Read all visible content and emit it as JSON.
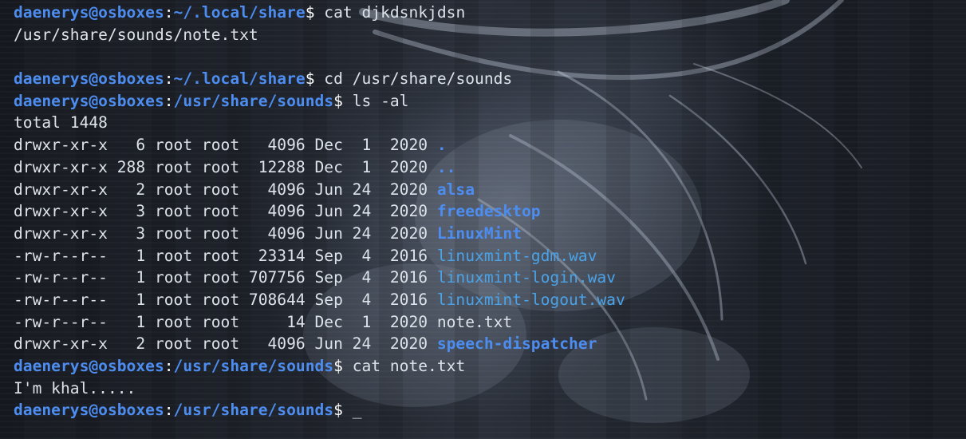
{
  "window": {
    "type": "terminal"
  },
  "colors": {
    "prompt": "#4d8df0",
    "text": "#dde3ea",
    "directory": "#4d8df0",
    "audio_file": "#4aa3e8"
  },
  "lines": [
    {
      "kind": "prompt",
      "user": "daenerys@osboxes",
      "path": "~/.local/share",
      "command": "cat djkdsnkjdsn"
    },
    {
      "kind": "text",
      "text": "/usr/share/sounds/note.txt"
    },
    {
      "kind": "blank",
      "text": ""
    },
    {
      "kind": "prompt",
      "user": "daenerys@osboxes",
      "path": "~/.local/share",
      "command": "cd /usr/share/sounds"
    },
    {
      "kind": "prompt",
      "user": "daenerys@osboxes",
      "path": "/usr/share/sounds",
      "command": "ls -al"
    },
    {
      "kind": "text",
      "text": "total 1448"
    },
    {
      "kind": "entry",
      "meta": "drwxr-xr-x   6 root root   4096 Dec  1  2020 ",
      "name": ".",
      "type": "dir"
    },
    {
      "kind": "entry",
      "meta": "drwxr-xr-x 288 root root  12288 Dec  1  2020 ",
      "name": "..",
      "type": "dir"
    },
    {
      "kind": "entry",
      "meta": "drwxr-xr-x   2 root root   4096 Jun 24  2020 ",
      "name": "alsa",
      "type": "dir"
    },
    {
      "kind": "entry",
      "meta": "drwxr-xr-x   3 root root   4096 Jun 24  2020 ",
      "name": "freedesktop",
      "type": "dir"
    },
    {
      "kind": "entry",
      "meta": "drwxr-xr-x   3 root root   4096 Jun 24  2020 ",
      "name": "LinuxMint",
      "type": "dir"
    },
    {
      "kind": "entry",
      "meta": "-rw-r--r--   1 root root  23314 Sep  4  2016 ",
      "name": "linuxmint-gdm.wav",
      "type": "wav"
    },
    {
      "kind": "entry",
      "meta": "-rw-r--r--   1 root root 707756 Sep  4  2016 ",
      "name": "linuxmint-login.wav",
      "type": "wav"
    },
    {
      "kind": "entry",
      "meta": "-rw-r--r--   1 root root 708644 Sep  4  2016 ",
      "name": "linuxmint-logout.wav",
      "type": "wav"
    },
    {
      "kind": "entry",
      "meta": "-rw-r--r--   1 root root     14 Dec  1  2020 ",
      "name": "note.txt",
      "type": "plain"
    },
    {
      "kind": "entry",
      "meta": "drwxr-xr-x   2 root root   4096 Jun 24  2020 ",
      "name": "speech-dispatcher",
      "type": "dir"
    },
    {
      "kind": "prompt",
      "user": "daenerys@osboxes",
      "path": "/usr/share/sounds",
      "command": "cat note.txt"
    },
    {
      "kind": "text",
      "text": "I'm khal....."
    },
    {
      "kind": "prompt",
      "user": "daenerys@osboxes",
      "path": "/usr/share/sounds",
      "command": "",
      "cursor": "_"
    }
  ]
}
